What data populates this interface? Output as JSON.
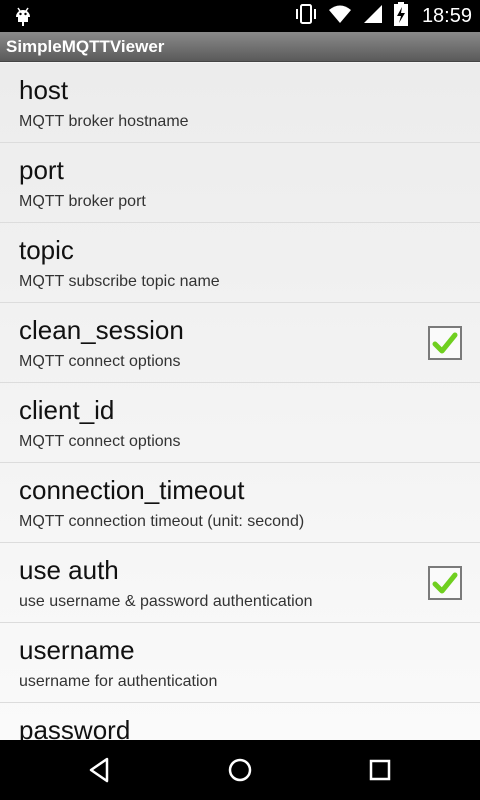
{
  "status_bar": {
    "time": "18:59",
    "icons": [
      "android-debug-icon",
      "vibrate-icon",
      "wifi-icon",
      "signal-icon",
      "battery-charging-icon"
    ]
  },
  "app": {
    "title": "SimpleMQTTViewer"
  },
  "preferences": [
    {
      "key": "host",
      "title": "host",
      "summary": "MQTT broker hostname",
      "has_checkbox": false
    },
    {
      "key": "port",
      "title": "port",
      "summary": "MQTT broker port",
      "has_checkbox": false
    },
    {
      "key": "topic",
      "title": "topic",
      "summary": "MQTT subscribe topic name",
      "has_checkbox": false
    },
    {
      "key": "clean_session",
      "title": "clean_session",
      "summary": "MQTT connect options",
      "has_checkbox": true,
      "checked": true
    },
    {
      "key": "client_id",
      "title": "client_id",
      "summary": "MQTT connect options",
      "has_checkbox": false
    },
    {
      "key": "connection_timeout",
      "title": "connection_timeout",
      "summary": "MQTT connection timeout (unit: second)",
      "has_checkbox": false
    },
    {
      "key": "use_auth",
      "title": "use auth",
      "summary": "use username & password authentication",
      "has_checkbox": true,
      "checked": true
    },
    {
      "key": "username",
      "title": "username",
      "summary": "username for authentication",
      "has_checkbox": false
    },
    {
      "key": "password",
      "title": "password",
      "summary": "",
      "has_checkbox": false
    }
  ],
  "nav_bar": {
    "buttons": [
      "back-icon",
      "home-icon",
      "recents-icon"
    ]
  },
  "colors": {
    "check_mark": "#6fcf1f",
    "status_bar": "#000000",
    "title_bar": "#6e6e6e"
  }
}
